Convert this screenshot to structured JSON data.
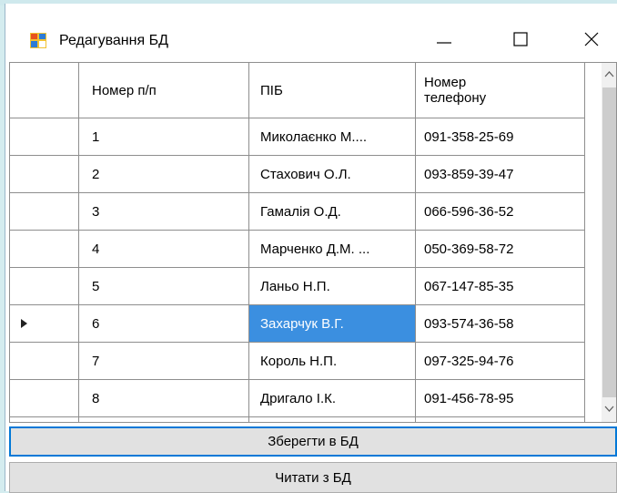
{
  "window": {
    "title": "Редагування БД"
  },
  "controls": {
    "minimize": "—",
    "maximize": "☐",
    "close": "✕"
  },
  "grid": {
    "columns": [
      "Номер п/п",
      "ПІБ",
      "Номер\nтелефону"
    ],
    "rows": [
      [
        "1",
        "Миколаєнко М....",
        "091-358-25-69"
      ],
      [
        "2",
        "Стахович О.Л.",
        "093-859-39-47"
      ],
      [
        "3",
        "Гамалія О.Д.",
        "066-596-36-52"
      ],
      [
        "4",
        "Марченко Д.М.  ...",
        "050-369-58-72"
      ],
      [
        "5",
        "Ланьо Н.П.",
        "067-147-85-35"
      ],
      [
        "6",
        "Захарчук В.Г.",
        "093-574-36-58"
      ],
      [
        "7",
        "Король Н.П.",
        "097-325-94-76"
      ],
      [
        "8",
        "Дригало І.К.",
        "091-456-78-95"
      ]
    ],
    "current_row_index": 5,
    "selected_cell": {
      "row": 5,
      "col": 1
    },
    "selection_color": "#3b8fe0"
  },
  "buttons": {
    "save": "Зберегти в БД",
    "read": "Читати з БД"
  }
}
